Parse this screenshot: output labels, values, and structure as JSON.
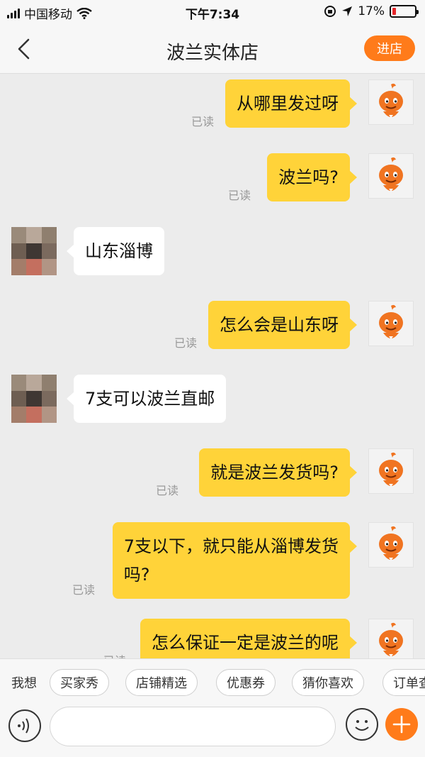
{
  "status_bar": {
    "carrier": "中国移动",
    "time": "下午7:34",
    "battery": "17%",
    "battery_level": 0.17
  },
  "nav": {
    "title": "波兰实体店",
    "shop_button": "进店",
    "back_icon": "chevron-left-icon"
  },
  "messages": [
    {
      "side": "out",
      "text": "从哪里发过呀",
      "read": "已读"
    },
    {
      "side": "out",
      "text": "波兰吗?",
      "read": "已读"
    },
    {
      "side": "in",
      "text": "山东淄博"
    },
    {
      "side": "out",
      "text": "怎么会是山东呀",
      "read": "已读"
    },
    {
      "side": "in",
      "text": "7支可以波兰直邮"
    },
    {
      "side": "out",
      "text": "就是波兰发货吗?",
      "read": "已读"
    },
    {
      "side": "out",
      "text": "7支以下，就只能从淄博发货\n吗?",
      "read": "已读"
    },
    {
      "side": "out",
      "text": "怎么保证一定是波兰的呢",
      "read": "已读"
    }
  ],
  "quick_replies": {
    "label": "我想",
    "chips": [
      "买家秀",
      "店铺精选",
      "优惠券",
      "猜你喜欢",
      "订单查询"
    ]
  },
  "input": {
    "placeholder": ""
  },
  "colors": {
    "accent": "#ff7b1a",
    "bubble_out": "#ffd339",
    "bubble_in": "#ffffff",
    "background": "#ececec"
  }
}
